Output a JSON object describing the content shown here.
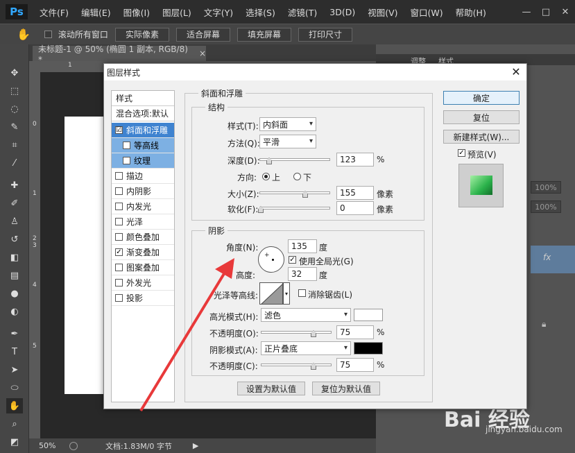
{
  "app": {
    "logo": "Ps",
    "menus": [
      "文件(F)",
      "编辑(E)",
      "图像(I)",
      "图层(L)",
      "文字(Y)",
      "选择(S)",
      "滤镜(T)",
      "3D(D)",
      "视图(V)",
      "窗口(W)",
      "帮助(H)"
    ],
    "window_buttons": [
      "—",
      "□",
      "✕"
    ]
  },
  "options_bar": {
    "scroll_all_label": "滚动所有窗口",
    "buttons": [
      "实际像素",
      "适合屏幕",
      "填充屏幕",
      "打印尺寸"
    ]
  },
  "document": {
    "tab_title": "未标题-1 @ 50% (椭圆 1 副本, RGB/8) *",
    "tab_close": "×",
    "ruler_ticks_left": [
      "0",
      "1",
      "2",
      "3",
      "4",
      "5"
    ],
    "ruler_top_label": "1"
  },
  "status_bar": {
    "zoom": "50%",
    "doc_info": "文档:1.83M/0 字节"
  },
  "right_panel": {
    "tabs": [
      "调整",
      "样式"
    ],
    "opacity_1": "100%",
    "opacity_2": "100%",
    "fx_label": "fx"
  },
  "dialog": {
    "title": "图层样式",
    "close": "✕",
    "styles_list": {
      "header": "样式",
      "blend_options": "混合选项:默认",
      "items": [
        {
          "label": "斜面和浮雕",
          "checked": "☑",
          "selected": true
        },
        {
          "label": "等高线",
          "checked": "",
          "sub": true
        },
        {
          "label": "纹理",
          "checked": "",
          "sub": true
        },
        {
          "label": "描边",
          "checked": ""
        },
        {
          "label": "内阴影",
          "checked": ""
        },
        {
          "label": "内发光",
          "checked": ""
        },
        {
          "label": "光泽",
          "checked": ""
        },
        {
          "label": "颜色叠加",
          "checked": ""
        },
        {
          "label": "渐变叠加",
          "checked": "✓"
        },
        {
          "label": "图案叠加",
          "checked": ""
        },
        {
          "label": "外发光",
          "checked": ""
        },
        {
          "label": "投影",
          "checked": ""
        }
      ]
    },
    "bevel": {
      "group_title": "斜面和浮雕",
      "structure_title": "结构",
      "style_label": "样式(T):",
      "style_value": "内斜面",
      "technique_label": "方法(Q):",
      "technique_value": "平滑",
      "depth_label": "深度(D):",
      "depth_value": "123",
      "depth_unit": "%",
      "direction_label": "方向:",
      "direction_up": "上",
      "direction_down": "下",
      "size_label": "大小(Z):",
      "size_value": "155",
      "size_unit": "像素",
      "soften_label": "软化(F):",
      "soften_value": "0",
      "soften_unit": "像素"
    },
    "shading": {
      "title": "阴影",
      "angle_label": "角度(N):",
      "angle_value": "135",
      "angle_unit": "度",
      "global_light_label": "使用全局光(G)",
      "altitude_label": "高度:",
      "altitude_value": "32",
      "altitude_unit": "度",
      "gloss_contour_label": "光泽等高线:",
      "antialias_label": "消除锯齿(L)",
      "highlight_mode_label": "高光模式(H):",
      "highlight_mode_value": "滤色",
      "highlight_color": "#ffffff",
      "highlight_opacity_label": "不透明度(O):",
      "highlight_opacity_value": "75",
      "shadow_mode_label": "阴影模式(A):",
      "shadow_mode_value": "正片叠底",
      "shadow_color": "#000000",
      "shadow_opacity_label": "不透明度(C):",
      "shadow_opacity_value": "75",
      "percent": "%"
    },
    "footer_buttons": {
      "make_default": "设置为默认值",
      "reset_default": "复位为默认值"
    },
    "right_buttons": {
      "ok": "确定",
      "reset": "复位",
      "new_style": "新建样式(W)...",
      "preview_label": "预览(V)"
    }
  },
  "watermark": {
    "brand": "Bai 经验",
    "url": "jingyan.baidu.com"
  },
  "colors": {
    "accent_selected": "#3f83d0",
    "accent_sub": "#7db0e3",
    "annotation_arrow": "#e8393a"
  }
}
